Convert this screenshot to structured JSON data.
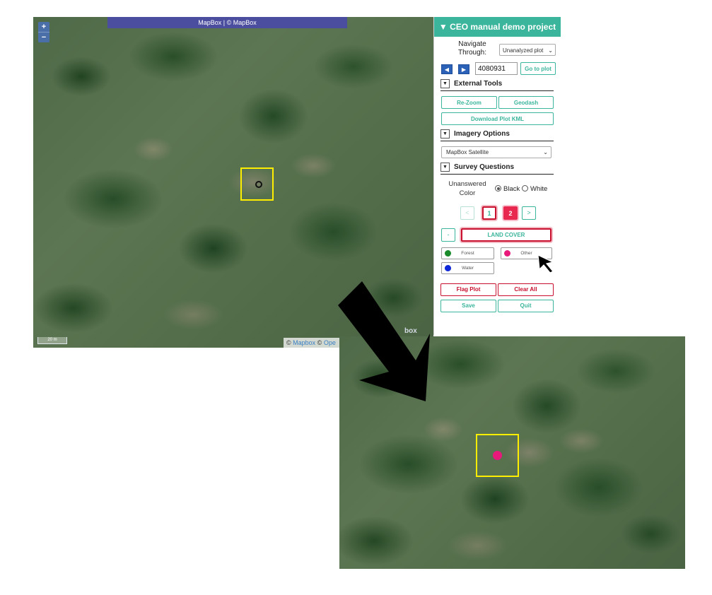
{
  "colors": {
    "accent": "#3bb59c",
    "plot_box": "#ffee00",
    "danger": "#c8102e"
  },
  "map": {
    "attribution_top": "MapBox | © MapBox",
    "scale_label": "20 m",
    "zoom_in": "+",
    "zoom_out": "−",
    "bottom_attr_prefix": "© ",
    "bottom_attr_link1": "Mapbox",
    "bottom_attr_mid": " © ",
    "bottom_attr_link2": "Ope",
    "logo_fragment": "box",
    "plot_marker_color_zoom": "#e8197a"
  },
  "panel": {
    "title": "▼ CEO manual demo project",
    "nav_label": "Navigate Through:",
    "nav_select": "Unanalyzed plot",
    "prev_icon": "◀",
    "next_icon": "▶",
    "plot_id": "4080931",
    "goto_label": "Go to plot",
    "external_tools": "External Tools",
    "rezoom": "Re-Zoom",
    "geodash": "Geodash",
    "download_kml": "Download Plot KML",
    "imagery_options": "Imagery Options",
    "imagery_select": "MapBox Satellite",
    "survey_questions": "Survey Questions",
    "unanswered_label": "Unanswered Color",
    "radio_black": "Black",
    "radio_white": "White",
    "pager_prev": "<",
    "pager_q1": "1",
    "pager_q2": "2",
    "pager_next": ">",
    "collapse": "-",
    "question": "LAND COVER",
    "answers": [
      {
        "label": "Forest",
        "color": "#1a8a2a"
      },
      {
        "label": "Other",
        "color": "#e8197a"
      },
      {
        "label": "Water",
        "color": "#1029d8"
      }
    ],
    "flag_plot": "Flag Plot",
    "clear_all": "Clear All",
    "save": "Save",
    "quit": "Quit"
  }
}
